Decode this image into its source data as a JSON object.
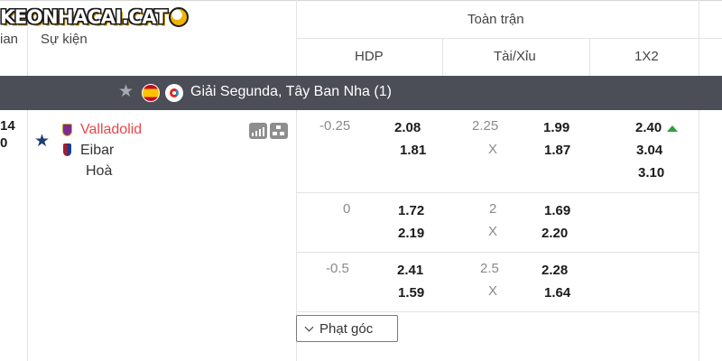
{
  "brand": {
    "logo_text": "KEONHACAI.CAT"
  },
  "header": {
    "time_col": "ian",
    "event_col": "Sự kiện",
    "full_match": "Toàn trận",
    "hdp": "HDP",
    "ou": "Tài/Xỉu",
    "x12": "1X2"
  },
  "league": {
    "name": "Giải Segunda, Tây Ban Nha (1)",
    "flag": "spain-flag-icon",
    "logo": "laliga-icon"
  },
  "match": {
    "time_top": "14",
    "time_bottom": "0",
    "home": "Valladolid",
    "away": "Eibar",
    "draw": "Hoà"
  },
  "odds_rows": [
    {
      "hdp_line": "-0.25",
      "hdp_home": "2.08",
      "hdp_away": "1.81",
      "ou_line": "2.25",
      "ou_under": "X",
      "ou_over": "1.99",
      "ou_over2": "1.87"
    },
    {
      "hdp_line": "0",
      "hdp_home": "1.72",
      "hdp_away": "2.19",
      "ou_line": "2",
      "ou_under": "X",
      "ou_over": "1.69",
      "ou_over2": "2.20"
    },
    {
      "hdp_line": "-0.5",
      "hdp_home": "2.41",
      "hdp_away": "1.59",
      "ou_line": "2.5",
      "ou_under": "X",
      "ou_over": "2.28",
      "ou_over2": "1.64"
    }
  ],
  "x12": {
    "home": "2.40",
    "draw_odd": "3.04",
    "away": "3.10",
    "trend": "up",
    "trend_color": "#2e9e3f"
  },
  "corner_button": "Phạt góc",
  "colors": {
    "league_bar": "#4b4d57",
    "home_team": "#e5484d",
    "favorite_star": "#1f3d73"
  }
}
